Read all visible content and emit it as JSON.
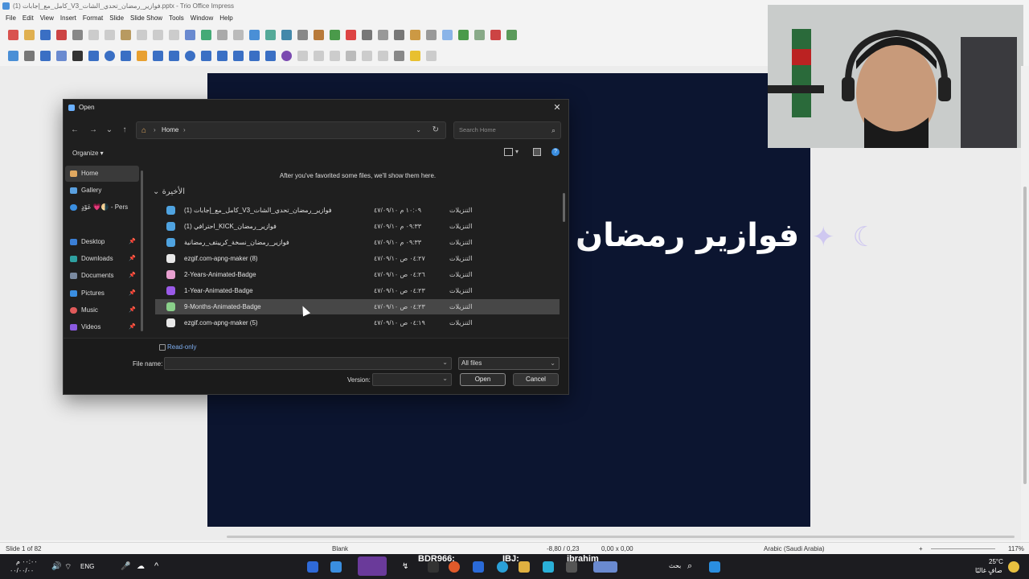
{
  "window": {
    "title": "كامل_مع_إجابات (1)_V3_فوازير_رمضان_تحدي_الشات.pptx - Trio Office Impress"
  },
  "menu": [
    "File",
    "Edit",
    "View",
    "Insert",
    "Format",
    "Slide",
    "Slide Show",
    "Tools",
    "Window",
    "Help"
  ],
  "slide": {
    "title": "فوازير رمضان"
  },
  "dialog": {
    "title": "Open",
    "address": {
      "crumb": "Home"
    },
    "search_placeholder": "Search Home",
    "organize": "Organize ▾",
    "favorites_msg": "After you've favorited some files, we'll show them here.",
    "group_header": "الأخيرة",
    "sidebar": [
      {
        "label": "Home",
        "icon": "home-icon",
        "color": "#e0a860",
        "selected": true
      },
      {
        "label": "Gallery",
        "icon": "gallery-icon",
        "color": "#5aa0e0"
      },
      {
        "label": "عَوْدٍ 💗🌗 - Pers",
        "icon": "cloud-icon",
        "color": "#3a8ee0"
      },
      {
        "label": "Desktop",
        "icon": "desktop-icon",
        "color": "#3b7fd6",
        "pinned": true
      },
      {
        "label": "Downloads",
        "icon": "download-icon",
        "color": "#2ea0a0",
        "pinned": true
      },
      {
        "label": "Documents",
        "icon": "documents-icon",
        "color": "#7a8aa0",
        "pinned": true
      },
      {
        "label": "Pictures",
        "icon": "pictures-icon",
        "color": "#3a8ee0",
        "pinned": true
      },
      {
        "label": "Music",
        "icon": "music-icon",
        "color": "#e05a5a",
        "pinned": true
      },
      {
        "label": "Videos",
        "icon": "videos-icon",
        "color": "#8a5ae0",
        "pinned": true
      }
    ],
    "files": [
      {
        "name": "(1) كامل_مع_إجابات_V3_فوازير_رمضان_تحدي_الشات",
        "date": "١٠:٠٩ م ٤٧/٠٩/١٠",
        "folder": "التنزيلات",
        "icon": "pptx-icon",
        "color": "#4fa3e0"
      },
      {
        "name": "(1) احترافي_KICK_فوازير_رمضان",
        "date": "٠٩:٣٣ م ٤٧/٠٩/١٠",
        "folder": "التنزيلات",
        "icon": "pptx-icon",
        "color": "#4fa3e0"
      },
      {
        "name": "فوازير_رمضان_نسخة_كرييتف_رمضانية",
        "date": "٠٩:٣٣ م ٤٧/٠٩/١٠",
        "folder": "التنزيلات",
        "icon": "pptx-icon",
        "color": "#4fa3e0"
      },
      {
        "name": "ezgif.com-apng-maker (8)",
        "date": "٠٤:٢٧ ص ٤٧/٠٩/١٠",
        "folder": "التنزيلات",
        "icon": "image-icon",
        "color": "#e8e8e8"
      },
      {
        "name": "2-Years-Animated-Badge",
        "date": "٠٤:٢٦ ص ٤٧/٠٩/١٠",
        "folder": "التنزيلات",
        "icon": "badge-icon",
        "color": "#e8a0d0"
      },
      {
        "name": "1-Year-Animated-Badge",
        "date": "٠٤:٢٣ ص ٤٧/٠٩/١٠",
        "folder": "التنزيلات",
        "icon": "badge-icon",
        "color": "#9a5ae8"
      },
      {
        "name": "9-Months-Animated-Badge",
        "date": "٠٤:٢٣ ص ٤٧/٠٩/١٠",
        "folder": "التنزيلات",
        "icon": "badge-icon",
        "color": "#8ad08a",
        "highlight": true
      },
      {
        "name": "ezgif.com-apng-maker (5)",
        "date": "٠٤:١٩ ص ٤٧/٠٩/١٠",
        "folder": "التنزيلات",
        "icon": "image-icon",
        "color": "#e8e8e8"
      }
    ],
    "read_only": "Read-only",
    "file_name_label": "File name:",
    "file_type": "All files",
    "version_label": "Version:",
    "open": "Open",
    "cancel": "Cancel"
  },
  "status": {
    "slide": "Slide 1 of 82",
    "layout": "Blank",
    "position": "-8,80 / 0,23",
    "size": "0,00 x 0,00",
    "language": "Arabic (Saudi Arabia)",
    "zoom": "117%"
  },
  "taskbar": {
    "lang": "ENG",
    "time_left": "٠٠:٠٠ م",
    "date_left": "٠٠/٠٠/٠٠",
    "search": "بحث",
    "ticker1": "BDR966:",
    "ticker2": "IBJ:",
    "ticker3": "ibrahim",
    "temp": "25°C",
    "weather": "صافٍ غالبًا"
  },
  "colors": {
    "accent": "#7eaef0",
    "slide_bg": "#0c1530",
    "dialog_bg": "#1f1f1f"
  }
}
